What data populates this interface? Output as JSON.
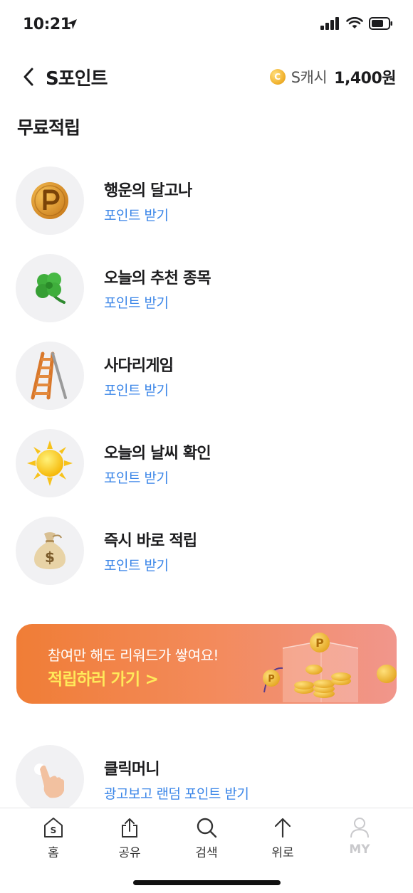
{
  "status_bar": {
    "time": "10:21"
  },
  "header": {
    "title": "S포인트",
    "cash_coin": "C",
    "cash_label": "S캐시",
    "cash_value": "1,400원"
  },
  "section": {
    "title": "무료적립"
  },
  "items": [
    {
      "title": "행운의 달고나",
      "sub": "포인트 받기",
      "icon": "dalgona-coin-icon"
    },
    {
      "title": "오늘의 추천 종목",
      "sub": "포인트 받기",
      "icon": "clover-icon"
    },
    {
      "title": "사다리게임",
      "sub": "포인트 받기",
      "icon": "ladder-icon"
    },
    {
      "title": "오늘의 날씨 확인",
      "sub": "포인트 받기",
      "icon": "sun-icon"
    },
    {
      "title": "즉시 바로 적립",
      "sub": "포인트 받기",
      "icon": "money-bag-icon"
    }
  ],
  "banner": {
    "subtitle": "참여만 해도 리워드가 쌓여요!",
    "cta": "적립하러 가기 >",
    "colors": {
      "from": "#f07d36",
      "to": "#f1968c",
      "cta": "#ffe95a"
    }
  },
  "click_money": {
    "title": "클릭머니",
    "sub": "광고보고 랜덤 포인트 받기",
    "icon": "tapping-hand-icon"
  },
  "tabs": [
    {
      "label": "홈",
      "icon": "home-s-icon"
    },
    {
      "label": "공유",
      "icon": "share-icon"
    },
    {
      "label": "검색",
      "icon": "search-icon"
    },
    {
      "label": "위로",
      "icon": "arrow-up-icon"
    },
    {
      "label": "MY",
      "icon": "person-icon"
    }
  ],
  "accent_color": "#3b86e8"
}
